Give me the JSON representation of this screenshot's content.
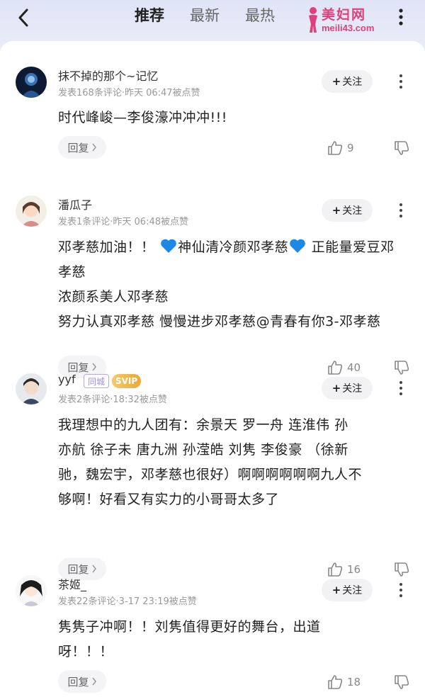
{
  "header": {
    "tabs": [
      {
        "label": "推荐",
        "active": true
      },
      {
        "label": "最新",
        "active": false
      },
      {
        "label": "最热",
        "active": false
      }
    ],
    "logo": {
      "title": "美妇网",
      "url": "meili43.com"
    }
  },
  "follow_label": "关注",
  "reply_label": "回复",
  "comments": [
    {
      "user": "抹不掉的那个~记忆",
      "meta": "发表168条评论·昨天 06:47被点赞",
      "text_lines": [
        "时代峰峻—李俊濠冲冲冲!!!"
      ],
      "likes": "9"
    },
    {
      "user": "潘瓜子",
      "meta": "发表1条评论·昨天 06:48被点赞",
      "segments": [
        "邓孝慈加油！！",
        "神仙清冷颜邓孝慈",
        " 正能量爱豆邓孝慈",
        " 浓颜系美人邓孝慈",
        " 努力认真邓孝慈",
        " 慢慢进步邓孝慈",
        "@青春有你3-邓孝慈"
      ],
      "likes": "40"
    },
    {
      "user": "yyf",
      "badges": [
        "同城",
        "SVIP"
      ],
      "meta": "发表2条评论·18:32被点赞",
      "text_lines": [
        "我理想中的九人团有：余景天  罗一舟  连淮伟  孙",
        "亦航  徐子未  唐九洲  孙滢皓  刘隽 李俊豪 （徐新",
        "驰，魏宏宇，邓孝慈也很好）啊啊啊啊啊啊九人不",
        "够啊！好看又有实力的小哥哥太多了"
      ],
      "likes": "16"
    },
    {
      "user": "茶姬_",
      "meta": "发表22条评论·3-17 23:19被点赞",
      "text_lines": [
        "隽隽子冲啊！！刘隽值得更好的舞台，出道",
        "呀！！！"
      ],
      "likes": "18"
    }
  ],
  "colors": {
    "accent": "#e0407a",
    "heart": "#1e88e5",
    "svip": "#e8a93a"
  },
  "icons": [
    "back-arrow-icon",
    "more-vertical-icon",
    "thumb-up-icon",
    "thumb-down-icon",
    "blue-heart-icon",
    "chevron-right-icon"
  ]
}
